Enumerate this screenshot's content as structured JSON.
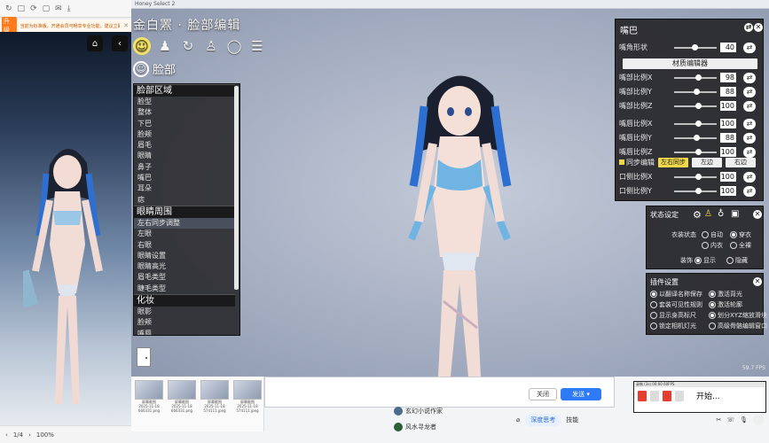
{
  "left_pane": {
    "toolbar_items": [
      "↻",
      "□",
      "⟳",
      "▢",
      "✉",
      "▢",
      "⤓",
      "▢"
    ],
    "notice_tag": "升级",
    "notice_text": "当前为标准版，开通会员可畅享专业功能，建议立即升级",
    "page_indicator": "1/4",
    "zoom": "100%"
  },
  "game": {
    "titlebar": "Honey Select 2",
    "title": "金白罴 · 脸部编辑",
    "section": "脸部",
    "face_list": {
      "group1_header": "脸部区域",
      "group1_items": [
        "脸型",
        "整体",
        "下巴",
        "脸颊",
        "眉毛",
        "眼睛",
        "鼻子",
        "嘴巴",
        "耳朵",
        "痣"
      ],
      "group2_header": "眼睛周围",
      "group2_items": [
        "左右同步调整",
        "左眼",
        "右眼",
        "眼睛设置",
        "眼睛高光",
        "眉毛类型",
        "睫毛类型"
      ],
      "group3_header": "化妆",
      "group3_items": [
        "眼影",
        "脸颊",
        "嘴唇"
      ]
    },
    "fps": "59.7 FPS"
  },
  "mouth_panel": {
    "title": "嘴巴",
    "mouth_shape_label": "嘴角形状",
    "mouth_shape_value": "40",
    "material_button": "材质编辑器",
    "sliders": [
      {
        "label": "嘴部比例X",
        "value": "98",
        "level": 0.55
      },
      {
        "label": "嘴部比例Y",
        "value": "88",
        "level": 0.5
      },
      {
        "label": "嘴部比例Z",
        "value": "100",
        "level": 0.55
      },
      {
        "label": "嘴唇比例X",
        "value": "100",
        "level": 0.55
      },
      {
        "label": "嘴唇比例Y",
        "value": "88",
        "level": 0.5
      },
      {
        "label": "嘴唇比例Z",
        "value": "100",
        "level": 0.55
      }
    ],
    "sync_label": "同步编辑",
    "sync_buttons": [
      "左右同步",
      "左边",
      "右边"
    ],
    "cheek_sliders": [
      {
        "label": "口侧比例X",
        "value": "100",
        "level": 0.55
      },
      {
        "label": "口侧比例Y",
        "value": "100",
        "level": 0.55
      }
    ]
  },
  "state_panel": {
    "title": "状态设定",
    "clothes_label": "衣装状态",
    "clothes_options": [
      "自动",
      "穿衣",
      "内衣",
      "全裸"
    ],
    "accessory_label": "装饰",
    "accessory_options": [
      "显示",
      "隐藏"
    ]
  },
  "plugin_panel": {
    "title": "插件设置",
    "options": [
      {
        "label": "以翻译名称保存",
        "on": true
      },
      {
        "label": "激活背光",
        "on": true
      },
      {
        "label": "套装可见性规则",
        "on": false
      },
      {
        "label": "激活轮廓",
        "on": true
      },
      {
        "label": "显示身高标尺",
        "on": false
      },
      {
        "label": "划分XYZ缩放滑块",
        "on": true
      },
      {
        "label": "锁定相机灯光",
        "on": false
      },
      {
        "label": "高级骨骼编辑窗口",
        "on": false
      }
    ]
  },
  "bottom": {
    "thumbs": [
      {
        "cap1": "屏幕截图",
        "cap2": "2025-11-18 666331.png"
      },
      {
        "cap1": "屏幕截图",
        "cap2": "2025-11-18 666331.png"
      },
      {
        "cap1": "屏幕截图",
        "cap2": "2025-11-18 574111.jpeg"
      },
      {
        "cap1": "屏幕截图",
        "cap2": "2025-11-18 574111.jpeg"
      }
    ],
    "close_label": "关闭",
    "send_label": "发送",
    "chat_entries": [
      "玄幻小说作家",
      "风水寻龙者"
    ],
    "chat_bar_pill": "深度思考",
    "chat_bar_skill": "技能",
    "rec_title": "录制 (3s)  00:00  60FPS",
    "rec_start": "开始..."
  },
  "colors": {
    "accent_yellow": "#f0d84a",
    "send_blue": "#2f7bf5"
  }
}
